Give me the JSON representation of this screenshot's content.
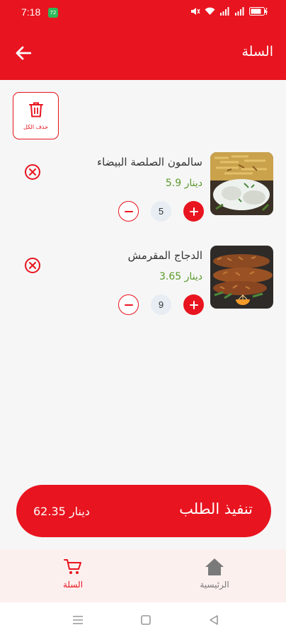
{
  "status_bar": {
    "time": "7:18",
    "badge": "72"
  },
  "header": {
    "title": "السلة",
    "back_icon": "arrow-left-icon"
  },
  "delete_all": {
    "label": "حذف الكل",
    "icon": "trash-icon"
  },
  "cart": {
    "items": [
      {
        "name": "سالمون الصلصة البيضاء",
        "price": "5.9 دينار",
        "quantity": "5",
        "image": "salmon-dish"
      },
      {
        "name": "الدجاج المقرمش",
        "price": "3.65 دينار",
        "quantity": "9",
        "image": "crispy-chicken"
      }
    ]
  },
  "checkout": {
    "label": "تنفيذ الطلب",
    "total": "62.35 دينار"
  },
  "bottom_nav": {
    "cart_label": "السلة",
    "home_label": "الرئيسية"
  },
  "colors": {
    "primary": "#e8141f",
    "price": "#5a9a2b",
    "nav_background": "#fcf0ef",
    "qty_background": "#e7edf3"
  }
}
